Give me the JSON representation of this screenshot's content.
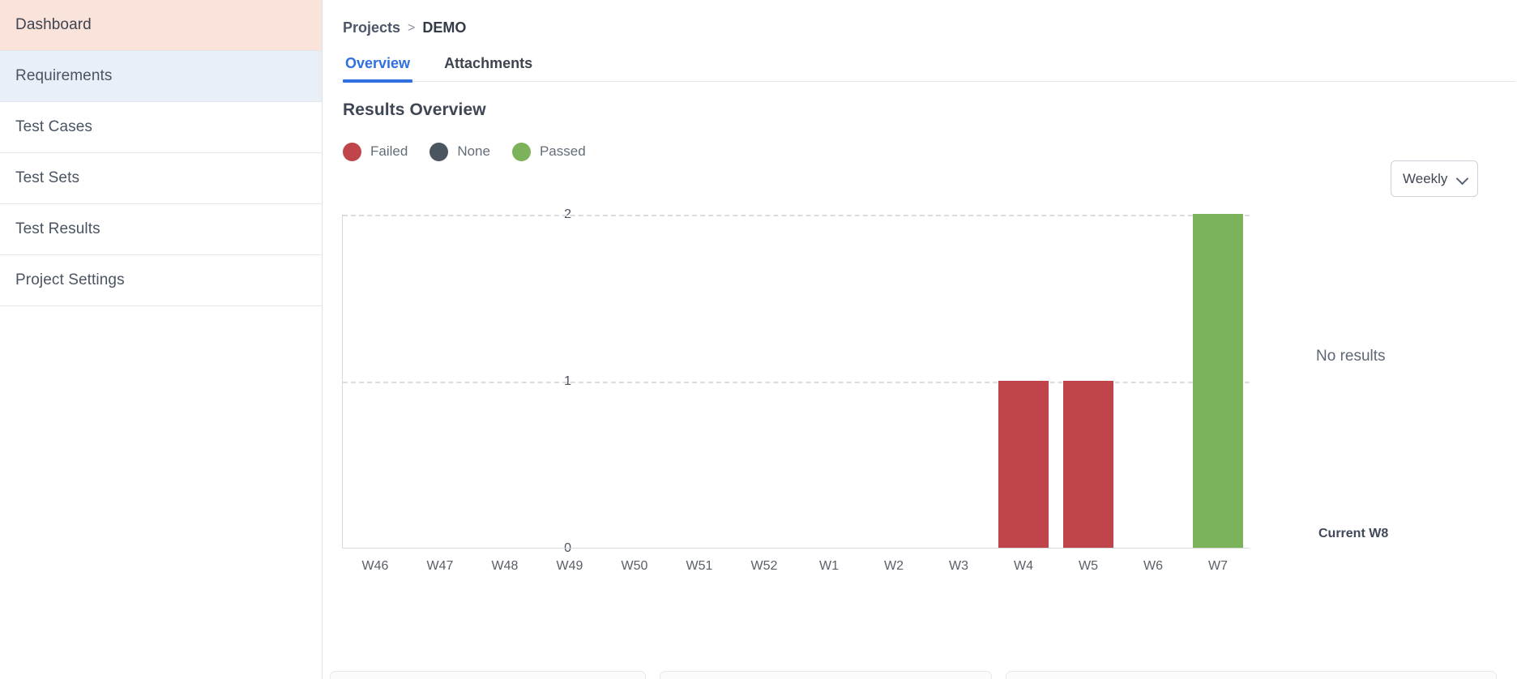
{
  "sidebar": {
    "items": [
      {
        "label": "Dashboard",
        "state": "active-a"
      },
      {
        "label": "Requirements",
        "state": "active-b"
      },
      {
        "label": "Test Cases",
        "state": ""
      },
      {
        "label": "Test Sets",
        "state": ""
      },
      {
        "label": "Test Results",
        "state": ""
      },
      {
        "label": "Project Settings",
        "state": ""
      }
    ]
  },
  "breadcrumb": {
    "root": "Projects",
    "separator": ">",
    "current": "DEMO"
  },
  "tabs": [
    {
      "label": "Overview",
      "active": true
    },
    {
      "label": "Attachments",
      "active": false
    }
  ],
  "section": {
    "title": "Results Overview"
  },
  "period_select": {
    "value": "Weekly",
    "icon": "chevron-down-icon"
  },
  "legend": [
    {
      "label": "Failed",
      "color": "#c0454b"
    },
    {
      "label": "None",
      "color": "#4a5560"
    },
    {
      "label": "Passed",
      "color": "#7cb35a"
    }
  ],
  "annotations": {
    "no_results": "No results",
    "current_week": "Current W8"
  },
  "colors": {
    "failed": "#c0454b",
    "none": "#4a5560",
    "passed": "#7cb35a",
    "accent": "#2f6fe0",
    "grid": "#d8dde2",
    "axis": "#d6dade",
    "sidebar_active_a": "#fae3db",
    "sidebar_active_b": "#e8eff7"
  },
  "chart_data": {
    "type": "bar",
    "title": "Results Overview",
    "xlabel": "",
    "ylabel": "",
    "ylim": [
      0,
      2
    ],
    "yticks": [
      0,
      1,
      2
    ],
    "grid": true,
    "legend_position": "top-left",
    "categories": [
      "W46",
      "W47",
      "W48",
      "W49",
      "W50",
      "W51",
      "W52",
      "W1",
      "W2",
      "W3",
      "W4",
      "W5",
      "W6",
      "W7"
    ],
    "series": [
      {
        "name": "Failed",
        "color": "#c0454b",
        "values": [
          0,
          0,
          0,
          0,
          0,
          0,
          0,
          0,
          0,
          0,
          1,
          1,
          0,
          0
        ]
      },
      {
        "name": "None",
        "color": "#4a5560",
        "values": [
          0,
          0,
          0,
          0,
          0,
          0,
          0,
          0,
          0,
          0,
          0,
          0,
          0,
          0
        ]
      },
      {
        "name": "Passed",
        "color": "#7cb35a",
        "values": [
          0,
          0,
          0,
          0,
          0,
          0,
          0,
          0,
          0,
          0,
          0,
          0,
          0,
          2
        ]
      }
    ],
    "annotations": [
      {
        "text": "No results",
        "position": "right-middle"
      },
      {
        "text": "Current W8",
        "position": "right-bottom"
      }
    ]
  }
}
